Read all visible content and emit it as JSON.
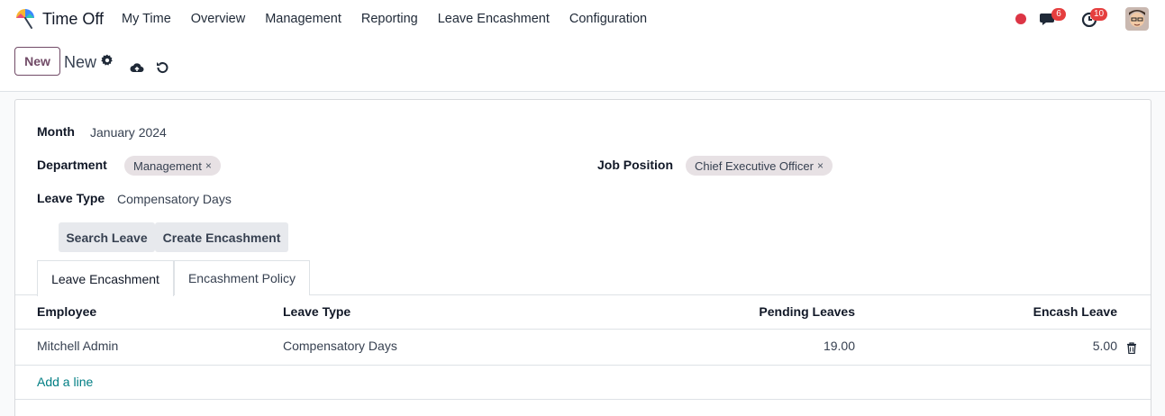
{
  "nav": {
    "app_name": "Time Off",
    "menu": [
      "My Time",
      "Overview",
      "Management",
      "Reporting",
      "Leave Encashment",
      "Configuration"
    ],
    "messages_count": "6",
    "activities_count": "10"
  },
  "control": {
    "new_button": "New",
    "record_title": "New"
  },
  "form": {
    "month_label": "Month",
    "month_value": "January 2024",
    "department_label": "Department",
    "department_tag": "Management",
    "job_position_label": "Job Position",
    "job_position_tag": "Chief Executive Officer",
    "leave_type_label": "Leave Type",
    "leave_type_value": "Compensatory Days",
    "tag_remove": "×",
    "search_leave_button": "Search Leave",
    "create_encashment_button": "Create Encashment"
  },
  "tabs": [
    "Leave Encashment",
    "Encashment Policy"
  ],
  "table": {
    "headers": [
      "Employee",
      "Leave Type",
      "Pending Leaves",
      "Encash Leave"
    ],
    "rows": [
      [
        "Mitchell Admin",
        "Compensatory Days",
        "19.00",
        "5.00"
      ]
    ],
    "add_line": "Add a line"
  },
  "colors": {
    "brand": "#714b67",
    "link": "#017e84",
    "badge": "#e53e3e",
    "recording": "#dc3545"
  }
}
